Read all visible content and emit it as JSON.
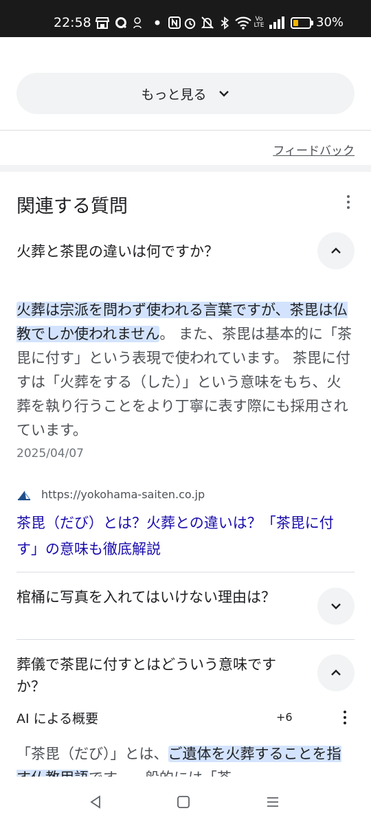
{
  "status_bar": {
    "time": "22:58",
    "battery_percent": "30%",
    "battery_level": 0.3,
    "battery_color": "#f0b400",
    "icons": [
      "store-icon",
      "q-app-icon",
      "notification-app-icon",
      "dot-icon",
      "nfc-icon",
      "alarm-icon",
      "mute-icon",
      "bluetooth-icon",
      "wifi-icon",
      "volte-icon",
      "signal-icon",
      "battery-icon"
    ]
  },
  "more_button": {
    "label": "もっと見る",
    "icon": "chevron-down-icon"
  },
  "feedback": {
    "label": "フィードバック"
  },
  "related_questions": {
    "title": "関連する質問",
    "items": [
      {
        "question": "火葬と茶毘の違いは何ですか？",
        "expanded": true
      },
      {
        "question": "棺桶に写真を入れてはいけない理由は？",
        "expanded": false
      },
      {
        "question": "葬儀で茶毘に付すとはどういう意味ですか？",
        "expanded": true
      }
    ]
  },
  "answer": {
    "highlighted": "火葬は宗派を問わず使われる言葉ですが、茶毘は仏教でしか使われません",
    "rest": "。 また、茶毘は基本的に「茶毘に付す」という表現で使われています。 茶毘に付すは「火葬をする（した）」という意味をもち、火葬を執り行うことをより丁寧に表す際にも採用されています。",
    "date": "2025/04/07",
    "source_url": "https://yokohama-saiten.co.jp",
    "link_title": "茶毘（だび）とは？火葬との違いは？「茶毘に付す」の意味も徹底解説"
  },
  "ai_overview": {
    "label": "AI による概要",
    "count": "+6",
    "text_before": "「茶毘（だび）」とは、",
    "text_highlight": "ご遺体を火葬することを指す仏教用語",
    "text_after": "です。一般的には「茶"
  },
  "colors": {
    "highlight": "#d3e3fd",
    "link": "#1a0dab",
    "chip_bg": "#f1f3f4"
  },
  "nav_bar": {
    "icons": [
      "back-icon",
      "home-icon",
      "recents-icon"
    ]
  }
}
